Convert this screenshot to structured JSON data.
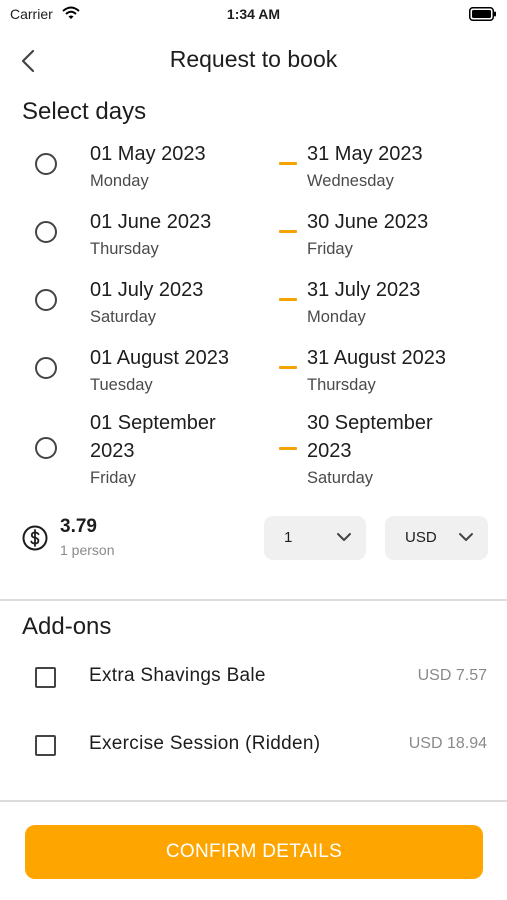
{
  "status_bar": {
    "carrier": "Carrier",
    "time": "1:34 AM"
  },
  "nav": {
    "title": "Request to book"
  },
  "select_days": {
    "title": "Select days",
    "ranges": [
      {
        "start_date": "01 May 2023",
        "start_day": "Monday",
        "end_date": "31 May 2023",
        "end_day": "Wednesday"
      },
      {
        "start_date": "01 June 2023",
        "start_day": "Thursday",
        "end_date": "30 June 2023",
        "end_day": "Friday"
      },
      {
        "start_date": "01 July 2023",
        "start_day": "Saturday",
        "end_date": "31 July 2023",
        "end_day": "Monday"
      },
      {
        "start_date": "01 August 2023",
        "start_day": "Tuesday",
        "end_date": "31 August 2023",
        "end_day": "Thursday"
      },
      {
        "start_date": "01 September 2023",
        "start_day": "Friday",
        "end_date": "30 September 2023",
        "end_day": "Saturday"
      }
    ]
  },
  "pricing": {
    "price": "3.79",
    "per": "1 person",
    "quantity": "1",
    "currency": "USD"
  },
  "addons": {
    "title": "Add-ons",
    "items": [
      {
        "label": "Extra Shavings Bale",
        "price": "USD 7.57"
      },
      {
        "label": "Exercise Session (Ridden)",
        "price": "USD 18.94"
      }
    ]
  },
  "confirm": {
    "label": "CONFIRM DETAILS"
  },
  "colors": {
    "accent": "#ffa500",
    "dash": "#f5a300"
  }
}
